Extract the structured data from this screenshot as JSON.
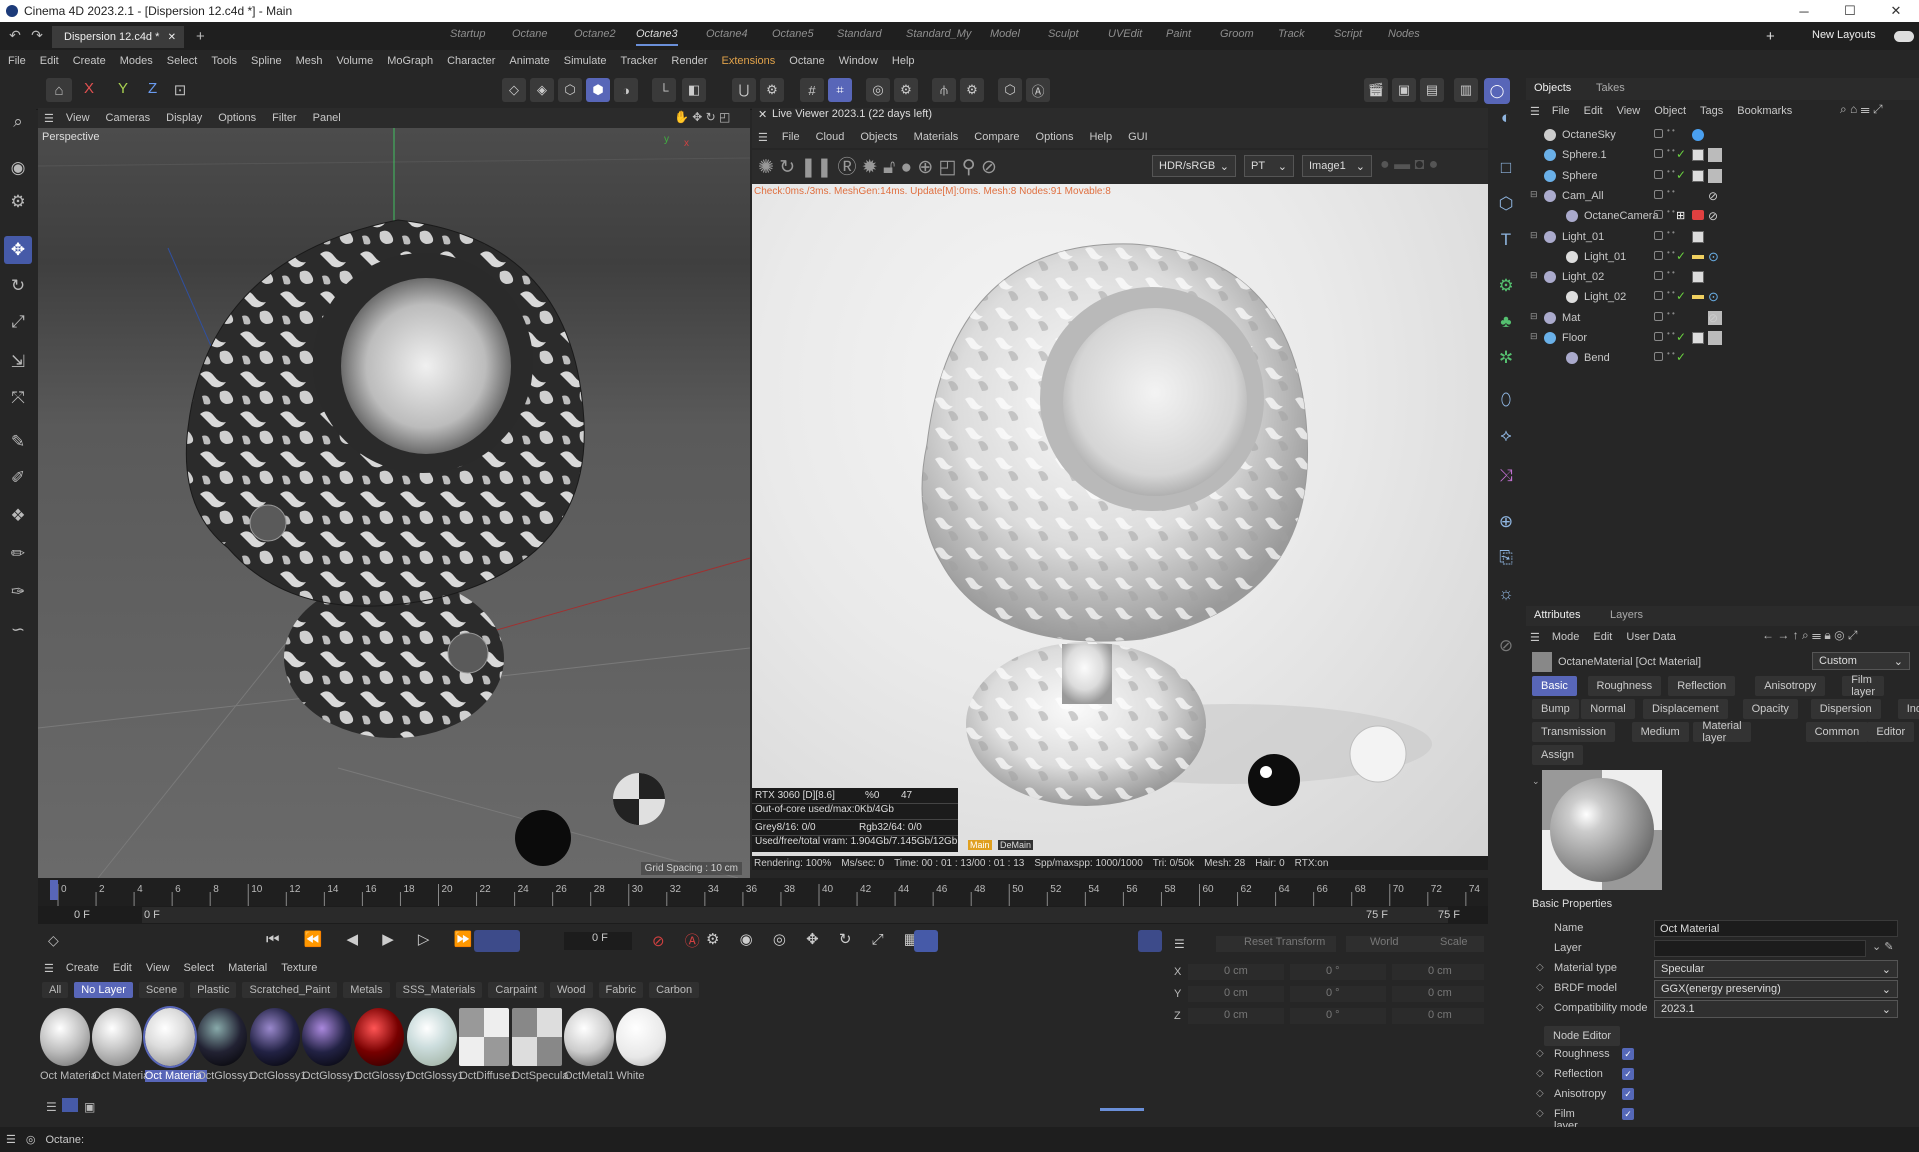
{
  "window": {
    "title": "Cinema 4D 2023.2.1 - [Dispersion 12.c4d *] - Main",
    "min": "─",
    "max": "☐",
    "close": "✕"
  },
  "doc_tab": {
    "label": "Dispersion 12.c4d *",
    "close": "✕",
    "add": "+"
  },
  "layouts": [
    "Startup",
    "Octane",
    "Octane2",
    "Octane3",
    "Octane4",
    "Octane5",
    "Standard",
    "Standard_My",
    "Model",
    "Sculpt",
    "UVEdit",
    "Paint",
    "Groom",
    "Track",
    "Script",
    "Nodes"
  ],
  "active_layout": "Octane3",
  "new_layouts": "New Layouts",
  "menu": [
    "File",
    "Edit",
    "Create",
    "Modes",
    "Select",
    "Tools",
    "Spline",
    "Mesh",
    "Volume",
    "MoGraph",
    "Character",
    "Animate",
    "Simulate",
    "Tracker",
    "Render",
    "Extensions",
    "Octane",
    "Window",
    "Help"
  ],
  "axes": {
    "x": "X",
    "y": "Y",
    "z": "Z"
  },
  "viewport": {
    "menu": [
      "View",
      "Cameras",
      "Display",
      "Options",
      "Filter",
      "Panel"
    ],
    "label": "Perspective",
    "grid": "Grid Spacing : 10 cm"
  },
  "liveviewer": {
    "title": "Live Viewer 2023.1 (22 days left)",
    "menu": [
      "File",
      "Cloud",
      "Objects",
      "Materials",
      "Compare",
      "Options",
      "Help",
      "GUI"
    ],
    "color_space": "HDR/sRGB",
    "kernel": "PT",
    "pass": "Image1",
    "stats": "Check:0ms./3ms. MeshGen:14ms. Update[M]:0ms. Mesh:8 Nodes:91 Movable:8",
    "gpu": {
      "name": "RTX 3060 [D][8.6]",
      "pct": "%0",
      "temp": "47",
      "ooc": "Out-of-core used/max:0Kb/4Gb",
      "grey": "Grey8/16: 0/0",
      "rgb": "Rgb32/64: 0/0",
      "vram": "Used/free/total vram: 1.904Gb/7.145Gb/12Gb",
      "tag_main": "Main",
      "tag_demain": "DeMain"
    },
    "status": {
      "rendering": "Rendering: 100%",
      "mssec": "Ms/sec: 0",
      "time": "Time: 00 : 01 : 13/00 : 01 : 13",
      "spp": "Spp/maxspp: 1000/1000",
      "tri": "Tri: 0/50k",
      "mesh": "Mesh: 28",
      "hair": "Hair: 0",
      "rtx": "RTX:on"
    }
  },
  "objects": {
    "tabs": [
      "Objects",
      "Takes"
    ],
    "menu": [
      "File",
      "Edit",
      "View",
      "Object",
      "Tags",
      "Bookmarks"
    ],
    "items": [
      {
        "name": "OctaneSky",
        "indent": 0
      },
      {
        "name": "Sphere.1",
        "indent": 0
      },
      {
        "name": "Sphere",
        "indent": 0
      },
      {
        "name": "Cam_All",
        "indent": 0
      },
      {
        "name": "OctaneCamera",
        "indent": 1
      },
      {
        "name": "Light_01",
        "indent": 0
      },
      {
        "name": "Light_01",
        "indent": 1
      },
      {
        "name": "Light_02",
        "indent": 0
      },
      {
        "name": "Light_02",
        "indent": 1
      },
      {
        "name": "Mat",
        "indent": 0
      },
      {
        "name": "Floor",
        "indent": 0
      },
      {
        "name": "Bend",
        "indent": 1
      }
    ]
  },
  "attributes": {
    "tabs": [
      "Attributes",
      "Layers"
    ],
    "menu": [
      "Mode",
      "Edit",
      "User Data"
    ],
    "object": "OctaneMaterial [Oct Material]",
    "preset": "Custom",
    "subtabs": [
      [
        "Basic",
        "Roughness",
        "Reflection",
        "Anisotropy",
        "Film layer"
      ],
      [
        "Bump",
        "Normal",
        "Displacement",
        "Opacity",
        "Dispersion",
        "Index"
      ],
      [
        "Transmission",
        "Medium",
        "Material layer",
        "Common",
        "Editor"
      ],
      [
        "Assign"
      ]
    ],
    "section": "Basic Properties",
    "name_label": "Name",
    "name": "Oct Material",
    "layer_label": "Layer",
    "layer": "",
    "material_type_label": "Material type",
    "material_type": "Specular",
    "brdf_label": "BRDF model",
    "brdf": "GGX(energy preserving)",
    "compat_label": "Compatibility mode",
    "compat": "2023.1",
    "node_editor": "Node Editor",
    "flags": [
      "Roughness",
      "Reflection",
      "Anisotropy",
      "Film layer"
    ]
  },
  "timeline": {
    "ticks": [
      "0",
      "2",
      "4",
      "6",
      "8",
      "10",
      "12",
      "14",
      "16",
      "18",
      "20",
      "22",
      "24",
      "26",
      "28",
      "30",
      "32",
      "34",
      "36",
      "38",
      "40",
      "42",
      "44",
      "46",
      "48",
      "50",
      "52",
      "54",
      "56",
      "58",
      "60",
      "62",
      "64",
      "66",
      "68",
      "70",
      "72",
      "74"
    ],
    "start": "0 F",
    "start2": "0 F",
    "end": "75 F",
    "end2": "75 F",
    "current": "0 F"
  },
  "coords": {
    "reset": "Reset Transform",
    "world": "World",
    "scale": "Scale",
    "rows": [
      {
        "axis": "X",
        "p": "0 cm",
        "r": "0 °",
        "s": "0 cm"
      },
      {
        "axis": "Y",
        "p": "0 cm",
        "r": "0 °",
        "s": "0 cm"
      },
      {
        "axis": "Z",
        "p": "0 cm",
        "r": "0 °",
        "s": "0 cm"
      }
    ]
  },
  "materials": {
    "menu": [
      "Create",
      "Edit",
      "View",
      "Select",
      "Material",
      "Texture"
    ],
    "filters": [
      "All",
      "No Layer",
      "Scene",
      "Plastic",
      "Scratched_Paint",
      "Metals",
      "SSS_Materials",
      "Carpaint",
      "Wood",
      "Fabric",
      "Carbon"
    ],
    "active_filter": "No Layer",
    "items": [
      "Oct Materia",
      "Oct Materia",
      "Oct Materia",
      "OctGlossy1.",
      "OctGlossy1.",
      "OctGlossy1.",
      "OctGlossy1.",
      "OctGlossy1",
      "OctDiffuse1",
      "OctSpecula",
      "OctMetal1",
      "White"
    ]
  },
  "status": {
    "text": "Octane:"
  }
}
